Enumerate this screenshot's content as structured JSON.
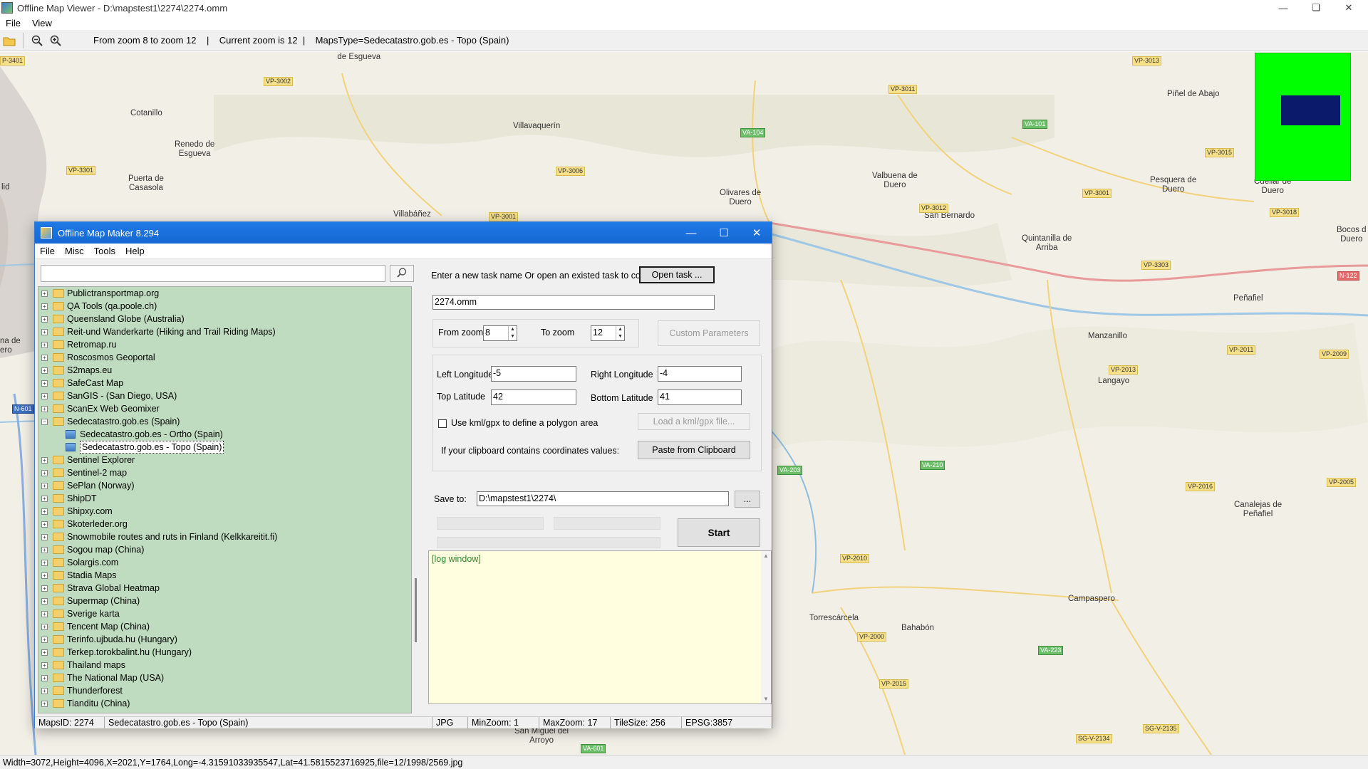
{
  "outer_window": {
    "title": "Offline Map Viewer - D:\\mapstest1\\2274\\2274.omm",
    "menu": [
      "File",
      "View"
    ],
    "controls": [
      "minimize",
      "restore",
      "close"
    ],
    "toolbar": {
      "icons": [
        "open-folder-icon",
        "zoom-out-icon",
        "zoom-in-icon"
      ],
      "status_text": "From zoom 8 to zoom 12    |    Current zoom is 12  |    MapsType=Sedecatastro.gob.es - Topo (Spain)"
    },
    "status_bar": "Width=3072,Height=4096,X=2021,Y=1764,Long=-4.31591033935547,Lat=41.5815523716925,file=12/1998/2569.jpg"
  },
  "map": {
    "labels": [
      {
        "text": "Villarmentero\nde Esgueva"
      },
      {
        "text": "Cotanillo"
      },
      {
        "text": "Renedo de\nEsgueva"
      },
      {
        "text": "Puerta de\nCasasola"
      },
      {
        "text": "Villavaquerín"
      },
      {
        "text": "Villabáñez"
      },
      {
        "text": "Olivares de\nDuero"
      },
      {
        "text": "Valbuena de\nDuero"
      },
      {
        "text": "San Bernardo"
      },
      {
        "text": "Quintanilla de\nArriba"
      },
      {
        "text": "Piñel de Abajo"
      },
      {
        "text": "Pesquera de\nDuero"
      },
      {
        "text": "Peñafiel"
      },
      {
        "text": "Manzanillo"
      },
      {
        "text": "Langayo"
      },
      {
        "text": "Canalejas de\nPeñafiel"
      },
      {
        "text": "Campaspero"
      },
      {
        "text": "Torrescárcela"
      },
      {
        "text": "Bahabón"
      },
      {
        "text": "San Miguel del\nArroyo"
      },
      {
        "text": "lid"
      },
      {
        "text": "na de\nero"
      },
      {
        "text": "Cuellar de\nDuero"
      },
      {
        "text": "Bocos d\nDuero"
      }
    ],
    "road_labels": [
      {
        "text": "P-3401",
        "style": "y"
      },
      {
        "text": "VP-3002",
        "style": "y"
      },
      {
        "text": "VP-3301",
        "style": "y"
      },
      {
        "text": "VP-3006",
        "style": "y"
      },
      {
        "text": "VP-3001",
        "style": "y"
      },
      {
        "text": "VA-104",
        "style": "g"
      },
      {
        "text": "VP-3011",
        "style": "y"
      },
      {
        "text": "VA-101",
        "style": "g"
      },
      {
        "text": "VP-3013",
        "style": "y"
      },
      {
        "text": "VP-3015",
        "style": "y"
      },
      {
        "text": "VP-3012",
        "style": "y"
      },
      {
        "text": "VP-3001",
        "style": "y"
      },
      {
        "text": "VP-3018",
        "style": "y"
      },
      {
        "text": "VP-3303",
        "style": "y"
      },
      {
        "text": "N-122",
        "style": "r"
      },
      {
        "text": "VP-2011",
        "style": "y"
      },
      {
        "text": "VP-2009",
        "style": "y"
      },
      {
        "text": "VP-2013",
        "style": "y"
      },
      {
        "text": "N-601",
        "style": "b"
      },
      {
        "text": "VA-203",
        "style": "g"
      },
      {
        "text": "VA-210",
        "style": "g"
      },
      {
        "text": "VP-2016",
        "style": "y"
      },
      {
        "text": "VP-2005",
        "style": "y"
      },
      {
        "text": "VP-2010",
        "style": "y"
      },
      {
        "text": "VP-2000",
        "style": "y"
      },
      {
        "text": "VA-223",
        "style": "g"
      },
      {
        "text": "VP-2015",
        "style": "y"
      },
      {
        "text": "VA-601",
        "style": "g"
      },
      {
        "text": "SG-V-2134",
        "style": "y"
      },
      {
        "text": "SG-V-2135",
        "style": "y"
      }
    ]
  },
  "dialog": {
    "title": "Offline Map Maker 8.294",
    "menu": [
      "File",
      "Misc",
      "Tools",
      "Help"
    ],
    "search": {
      "value": "",
      "icon": "search-icon"
    },
    "tree": [
      {
        "label": "Publictransportmap.org",
        "level": 0,
        "expanded": false,
        "type": "folder"
      },
      {
        "label": "QA Tools (qa.poole.ch)",
        "level": 0,
        "expanded": false,
        "type": "folder"
      },
      {
        "label": "Queensland Globe (Australia)",
        "level": 0,
        "expanded": false,
        "type": "folder"
      },
      {
        "label": "Reit-und Wanderkarte (Hiking and Trail Riding Maps)",
        "level": 0,
        "expanded": false,
        "type": "folder"
      },
      {
        "label": "Retromap.ru",
        "level": 0,
        "expanded": false,
        "type": "folder"
      },
      {
        "label": "Roscosmos Geoportal",
        "level": 0,
        "expanded": false,
        "type": "folder"
      },
      {
        "label": "S2maps.eu",
        "level": 0,
        "expanded": false,
        "type": "folder"
      },
      {
        "label": "SafeCast Map",
        "level": 0,
        "expanded": false,
        "type": "folder"
      },
      {
        "label": "SanGIS - (San Diego, USA)",
        "level": 0,
        "expanded": false,
        "type": "folder"
      },
      {
        "label": "ScanEx Web Geomixer",
        "level": 0,
        "expanded": false,
        "type": "folder"
      },
      {
        "label": "Sedecatastro.gob.es (Spain)",
        "level": 0,
        "expanded": true,
        "type": "folder"
      },
      {
        "label": "Sedecatastro.gob.es - Ortho (Spain)",
        "level": 1,
        "expanded": false,
        "type": "map"
      },
      {
        "label": "Sedecatastro.gob.es - Topo (Spain)",
        "level": 1,
        "expanded": false,
        "type": "map",
        "selected": true
      },
      {
        "label": "Sentinel Explorer",
        "level": 0,
        "expanded": false,
        "type": "folder"
      },
      {
        "label": "Sentinel-2 map",
        "level": 0,
        "expanded": false,
        "type": "folder"
      },
      {
        "label": "SePlan (Norway)",
        "level": 0,
        "expanded": false,
        "type": "folder"
      },
      {
        "label": "ShipDT",
        "level": 0,
        "expanded": false,
        "type": "folder"
      },
      {
        "label": "Shipxy.com",
        "level": 0,
        "expanded": false,
        "type": "folder"
      },
      {
        "label": "Skoterleder.org",
        "level": 0,
        "expanded": false,
        "type": "folder"
      },
      {
        "label": "Snowmobile routes and ruts in Finland (Kelkkareitit.fi)",
        "level": 0,
        "expanded": false,
        "type": "folder"
      },
      {
        "label": "Sogou map (China)",
        "level": 0,
        "expanded": false,
        "type": "folder"
      },
      {
        "label": "Solargis.com",
        "level": 0,
        "expanded": false,
        "type": "folder"
      },
      {
        "label": "Stadia Maps",
        "level": 0,
        "expanded": false,
        "type": "folder"
      },
      {
        "label": "Strava Global Heatmap",
        "level": 0,
        "expanded": false,
        "type": "folder"
      },
      {
        "label": "Supermap (China)",
        "level": 0,
        "expanded": false,
        "type": "folder"
      },
      {
        "label": "Sverige karta",
        "level": 0,
        "expanded": false,
        "type": "folder"
      },
      {
        "label": "Tencent Map (China)",
        "level": 0,
        "expanded": false,
        "type": "folder"
      },
      {
        "label": "Terinfo.ujbuda.hu (Hungary)",
        "level": 0,
        "expanded": false,
        "type": "folder"
      },
      {
        "label": "Terkep.torokbalint.hu (Hungary)",
        "level": 0,
        "expanded": false,
        "type": "folder"
      },
      {
        "label": "Thailand maps",
        "level": 0,
        "expanded": false,
        "type": "folder"
      },
      {
        "label": "The National Map (USA)",
        "level": 0,
        "expanded": false,
        "type": "folder"
      },
      {
        "label": "Thunderforest",
        "level": 0,
        "expanded": false,
        "type": "folder"
      },
      {
        "label": "Tianditu (China)",
        "level": 0,
        "expanded": false,
        "type": "folder"
      }
    ],
    "task": {
      "prompt": "Enter a new task name Or open an existed task to continue:",
      "open_button": "Open task ...",
      "name_value": "2274.omm"
    },
    "zoom": {
      "from_label": "From zoom",
      "from_value": "8",
      "to_label": "To zoom",
      "to_value": "12",
      "custom_button": "Custom Parameters"
    },
    "bounds": {
      "left_lon_label": "Left Longitude",
      "left_lon_value": "-5",
      "right_lon_label": "Right Longitude",
      "right_lon_value": "-4",
      "top_lat_label": "Top Latitude",
      "top_lat_value": "42",
      "bottom_lat_label": "Bottom Latitude",
      "bottom_lat_value": "41",
      "kml_checkbox_label": "Use kml/gpx to define a polygon area",
      "kml_checked": false,
      "load_kml_button": "Load a kml/gpx file...",
      "clipboard_label": "If your clipboard contains coordinates values:",
      "paste_button": "Paste from Clipboard"
    },
    "save": {
      "label": "Save to:",
      "value": "D:\\mapstest1\\2274\\",
      "browse_button": "...",
      "start_button": "Start"
    },
    "log": {
      "text": "[log window]"
    },
    "status": {
      "maps_id": "MapsID: 2274",
      "map_name": "Sedecatastro.gob.es - Topo (Spain)",
      "format": "JPG",
      "min_zoom": "MinZoom: 1",
      "max_zoom": "MaxZoom: 17",
      "tile_size": "TileSize: 256",
      "epsg": "EPSG:3857"
    }
  },
  "colors": {
    "tree_bg": "#c0dcc0",
    "overview_bg": "#00ff00",
    "overview_viewport": "#0b1a6b",
    "log_bg": "#ffffe0",
    "dialog_title": "#1a73e8"
  }
}
